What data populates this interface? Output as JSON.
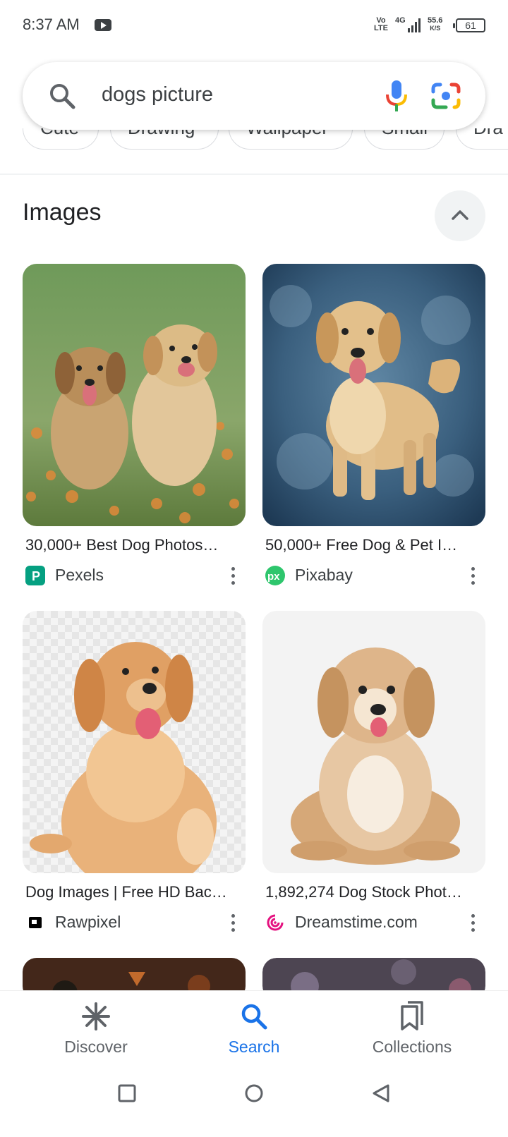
{
  "status_bar": {
    "time": "8:37 AM",
    "volte_top": "Vo",
    "volte_bottom": "LTE",
    "network": "4G",
    "speed_value": "55.6",
    "speed_unit": "K/S",
    "battery": "61"
  },
  "search": {
    "query": "dogs picture",
    "search_icon": "search-icon",
    "mic_icon": "mic-icon",
    "lens_icon": "google-lens-icon"
  },
  "chips": [
    "Cute",
    "Drawing",
    "Wallpaper",
    "Small",
    "Dra"
  ],
  "images_section": {
    "title": "Images",
    "collapse_icon": "chevron-up-icon"
  },
  "results": [
    {
      "caption": "30,000+ Best Dog Photos…",
      "source": "Pexels",
      "favicon_color": "#05a081"
    },
    {
      "caption": "50,000+ Free Dog & Pet I…",
      "source": "Pixabay",
      "favicon_color": "#2ec66d"
    },
    {
      "caption": "Dog Images | Free HD Bac…",
      "source": "Rawpixel",
      "favicon_color": "#000000"
    },
    {
      "caption": "1,892,274 Dog Stock Phot…",
      "source": "Dreamstime.com",
      "favicon_color": "#e4117f"
    }
  ],
  "bottom_nav": {
    "items": [
      {
        "label": "Discover",
        "icon": "asterisk-icon",
        "active": false
      },
      {
        "label": "Search",
        "icon": "search-icon",
        "active": true
      },
      {
        "label": "Collections",
        "icon": "bookmarks-icon",
        "active": false
      }
    ]
  },
  "system_nav": {
    "recents_icon": "square-icon",
    "home_icon": "circle-icon",
    "back_icon": "triangle-back-icon"
  },
  "colors": {
    "accent": "#1a73e8",
    "text": "#202124",
    "secondary_text": "#5f6368"
  }
}
